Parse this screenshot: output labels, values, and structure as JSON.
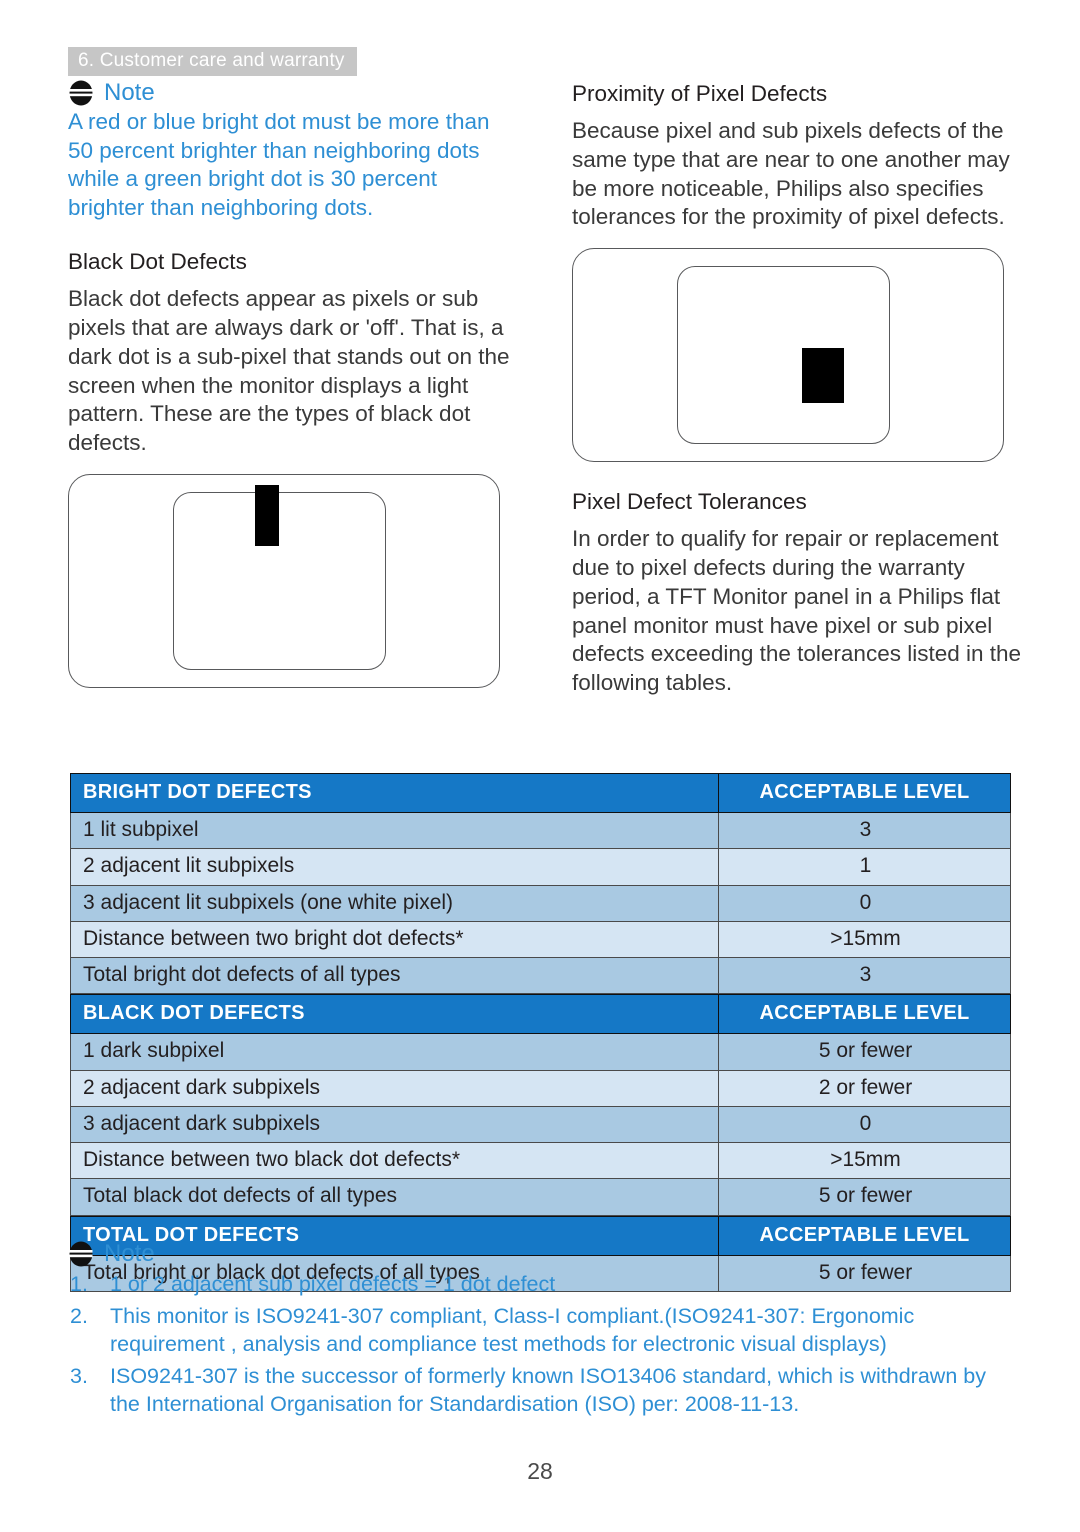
{
  "breadcrumb": "6. Customer care and warranty",
  "page_number": "28",
  "colors": {
    "accent_blue": "#2e8fd4",
    "table_header_blue": "#1578c6",
    "row_odd": "#a9c9e2",
    "row_even": "#d5e5f3",
    "breadcrumb_bg": "#c6c6c6"
  },
  "left_column": {
    "note": {
      "icon": "note-icon",
      "label": "Note",
      "text": "A red or blue bright dot must be more than 50 percent brighter than neighboring dots while a green bright dot is 30 percent brighter than neighboring dots."
    },
    "heading": "Black Dot Defects",
    "paragraph": "Black dot defects appear as pixels or sub pixels that are always dark or 'off'. That is, a dark dot is a sub-pixel that stands out on the screen when the monitor displays a light pattern. These are the types of black dot defects.",
    "figure": "black-dot-defect-monitor-illustration"
  },
  "right_column": {
    "heading_1": "Proximity of Pixel Defects",
    "paragraph_1": "Because pixel and sub pixels defects of the same type that are near to one another may be more noticeable, Philips also specifies tolerances for the proximity of pixel defects.",
    "figure": "pixel-defect-proximity-monitor-illustration",
    "heading_2": "Pixel Defect Tolerances",
    "paragraph_2": "In order to qualify for repair or replacement due to pixel defects during the warranty period, a TFT Monitor panel in a Philips flat panel monitor must have pixel or sub pixel defects exceeding the tolerances listed in the following tables."
  },
  "tables": [
    {
      "header_left": "BRIGHT DOT DEFECTS",
      "header_right": "ACCEPTABLE LEVEL",
      "rows": [
        {
          "label": "1 lit subpixel",
          "value": "3"
        },
        {
          "label": "2 adjacent lit subpixels",
          "value": "1"
        },
        {
          "label": "3 adjacent lit subpixels (one white pixel)",
          "value": "0"
        },
        {
          "label": "Distance between two bright dot defects*",
          "value": ">15mm"
        },
        {
          "label": "Total bright dot defects of all types",
          "value": "3"
        }
      ]
    },
    {
      "header_left": "BLACK DOT DEFECTS",
      "header_right": "ACCEPTABLE LEVEL",
      "rows": [
        {
          "label": "1 dark subpixel",
          "value": "5 or fewer"
        },
        {
          "label": "2 adjacent dark subpixels",
          "value": "2 or fewer"
        },
        {
          "label": "3 adjacent dark subpixels",
          "value": "0"
        },
        {
          "label": "Distance between two black dot defects*",
          "value": ">15mm"
        },
        {
          "label": "Total black dot defects of all types",
          "value": "5 or fewer"
        }
      ]
    },
    {
      "header_left": "TOTAL DOT DEFECTS",
      "header_right": "ACCEPTABLE LEVEL",
      "rows": [
        {
          "label": "Total bright or black dot defects of all types",
          "value": "5 or fewer"
        }
      ]
    }
  ],
  "footer_note": {
    "icon": "note-icon",
    "label": "Note",
    "items": [
      {
        "num": "1.",
        "text": "1 or 2 adjacent sub pixel defects = 1 dot defect"
      },
      {
        "num": "2.",
        "text": "This monitor is ISO9241-307 compliant, Class-I compliant.(ISO9241-307: Ergonomic requirement , analysis and compliance test methods for electronic visual displays)"
      },
      {
        "num": "3.",
        "text": "ISO9241-307 is the successor of formerly known ISO13406 standard, which is withdrawn by the International Organisation for Standardisation (ISO) per: 2008-11-13."
      }
    ]
  }
}
